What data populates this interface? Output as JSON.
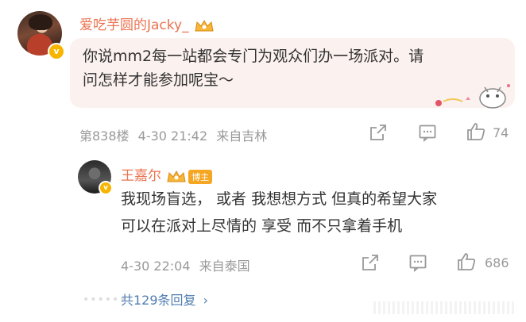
{
  "comment": {
    "username": "爱吃芋圆的Jacky_",
    "text_line1": "你说mm2每一站都会专门为观众们办一场派对。请",
    "text_line2": "问怎样才能参加呢宝～",
    "floor": "第838楼",
    "datetime": "4-30 21:42",
    "location": "来自吉林",
    "like_count": "74"
  },
  "reply": {
    "username": "王嘉尔",
    "badge": "博主",
    "text_line1": "我现场盲选， 或者 我想想方式 但真的希望大家",
    "text_line2": "可以在派对上尽情的 享受 而不只拿着手机",
    "datetime": "4-30 22:04",
    "location": "来自泰国",
    "like_count": "686"
  },
  "more_replies": "共129条回复",
  "colors": {
    "username": "#eb7350",
    "link": "#507daf",
    "meta": "#999999",
    "bubble": "#fbf1ef"
  },
  "icons": [
    "verified-badge-icon",
    "crown-icon",
    "share-icon",
    "comment-icon",
    "like-icon",
    "chevron-right-icon"
  ]
}
